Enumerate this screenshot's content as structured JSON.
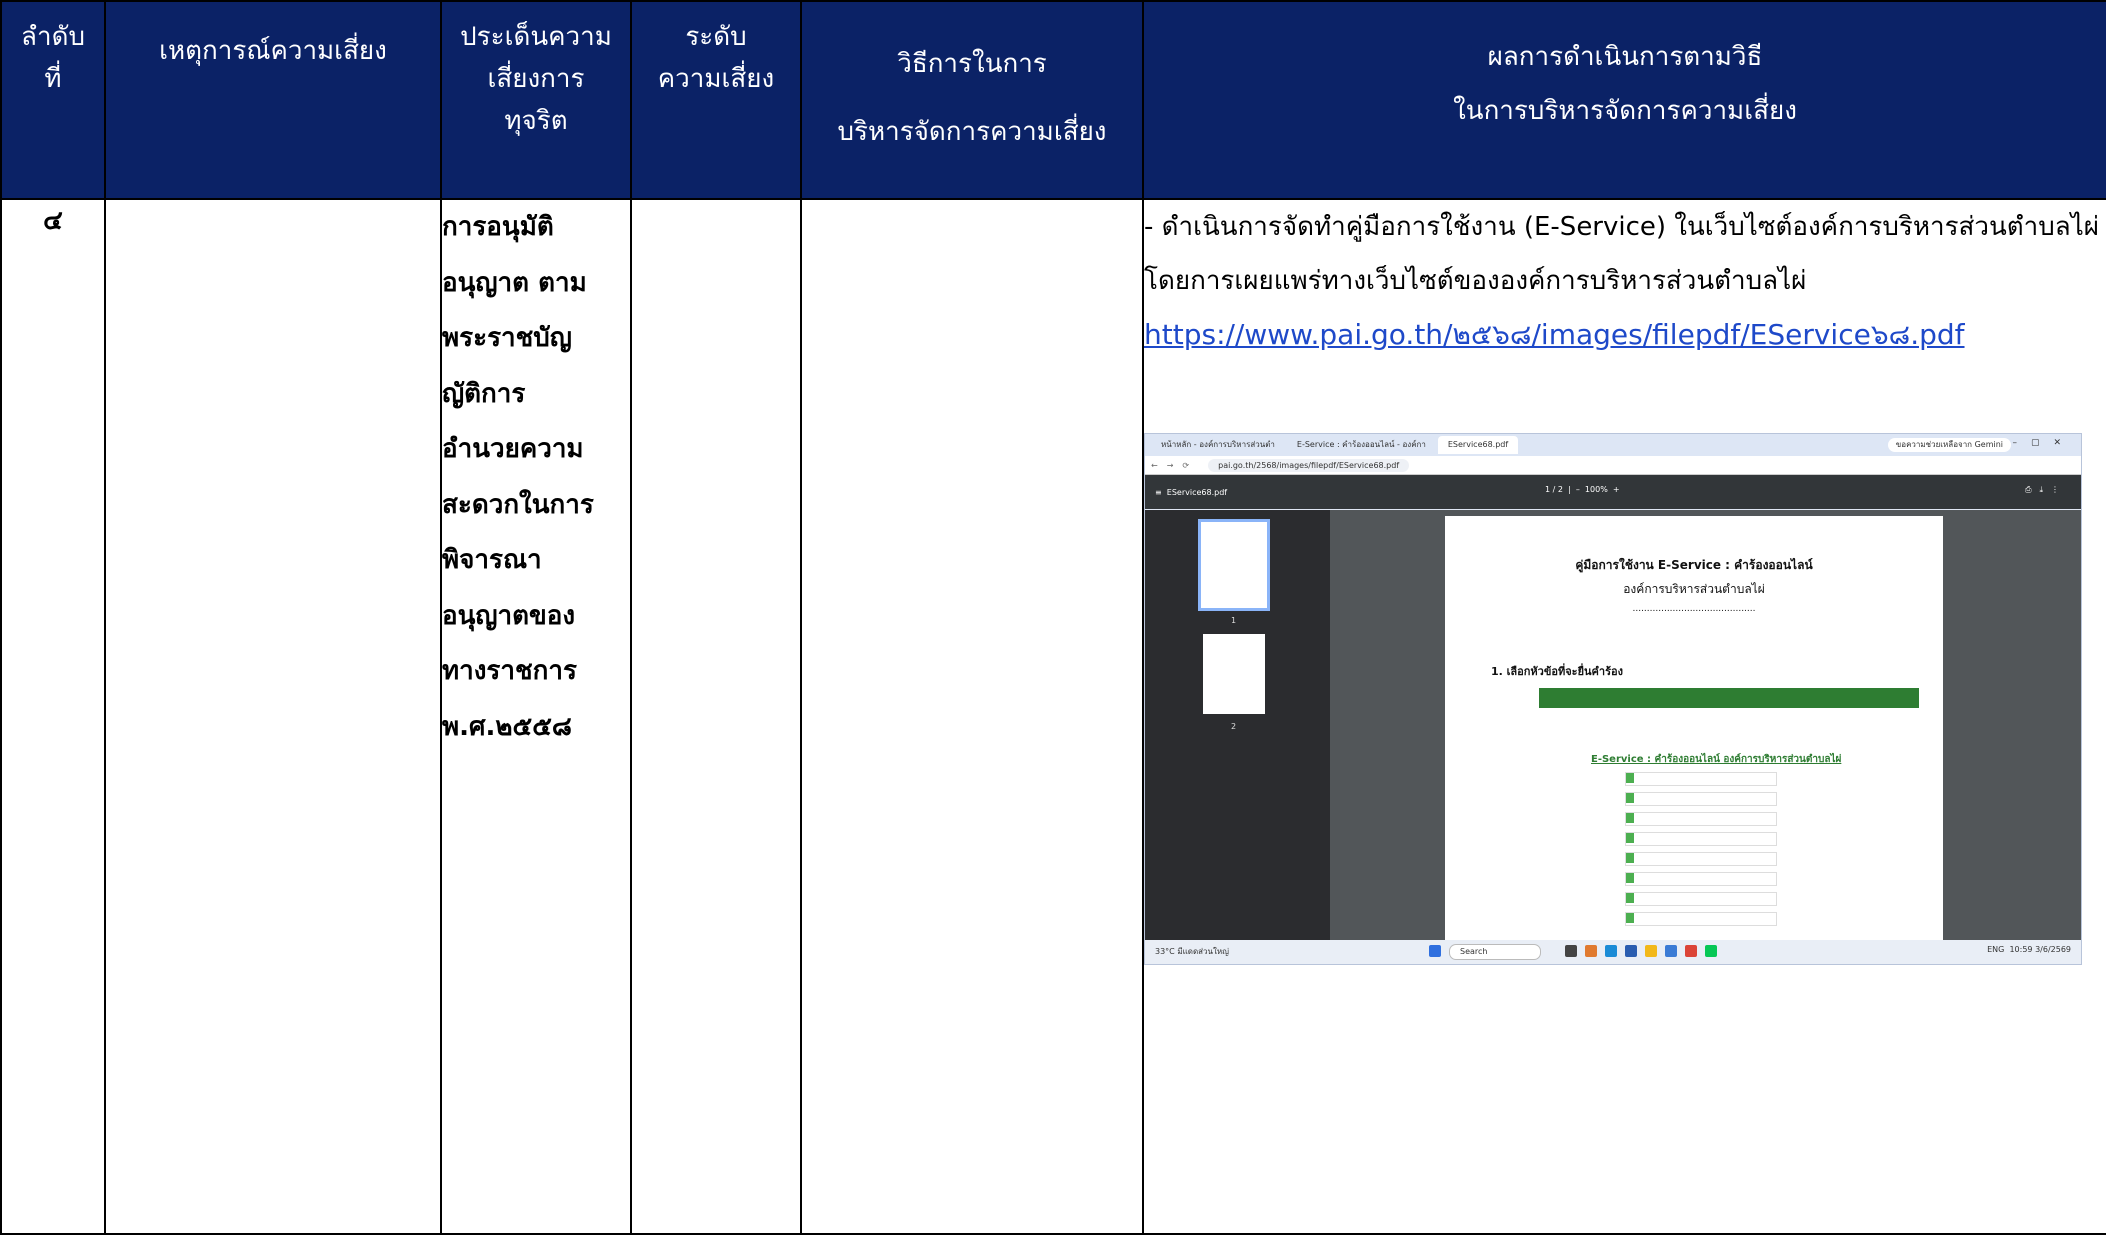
{
  "header": {
    "col1": [
      "ลำดับ",
      "ที่"
    ],
    "col2": [
      "เหตุการณ์ความเสี่ยง"
    ],
    "col3": [
      "ประเด็นความ",
      "เสี่ยงการ",
      "ทุจริต"
    ],
    "col4": [
      "ระดับ",
      "ความเสี่ยง"
    ],
    "col5": [
      "วิธีการในการ",
      "บริหารจัดการความเสี่ยง"
    ],
    "col6": [
      "ผลการดำเนินการตามวิธี",
      "ในการบริหารจัดการความเสี่ยง"
    ]
  },
  "row": {
    "number": "๔",
    "event": "",
    "issue_lines": [
      "การอนุมัติ",
      "อนุญาต ตาม",
      "พระราชบัญ",
      "ญัติการ",
      "อำนวยความ",
      "สะดวกในการ",
      "พิจารณา",
      "อนุญาตของ",
      "ทางราชการ",
      "พ.ศ.๒๕๕๘"
    ],
    "level": "",
    "method": "",
    "result_line1": "- ดำเนินการจัดทำคู่มือการใช้งาน (E-Service) ในเว็บไซต์องค์การบริหารส่วนตำบลไผ่",
    "result_line2": "โดยการเผยแพร่ทางเว็บไซต์ขององค์การบริหารส่วนตำบลไผ่",
    "result_link": "https://www.pai.go.th/๒๕๖๘/images/filepdf/EService๖๘.pdf"
  },
  "screenshot": {
    "tabs": [
      "หน้าหลัก - องค์การบริหารส่วนตำ",
      "E-Service : คำร้องออนไลน์ - องค์กา",
      "EService68.pdf"
    ],
    "gemini": "ขอความช่วยเหลือจาก Gemini",
    "url": "pai.go.th/2568/images/filepdf/EService68.pdf",
    "pdf_name": "EService68.pdf",
    "page_indicator": "1 / 2",
    "zoom": "100%",
    "thumb1": "1",
    "thumb2": "2",
    "doc_title": "คู่มือการใช้งาน E-Service : คำร้องออนไลน์",
    "doc_subtitle": "องค์การบริหารส่วนตำบลไผ่",
    "doc_dots": "...........................................",
    "step1": "1. เลือกหัวข้อที่จะยื่นคำร้อง",
    "eservice_heading": "E-Service : คำร้องออนไลน์ องค์การบริหารส่วนตำบลไผ่",
    "search": "Search",
    "weather": "33°C",
    "weather_sub": "มีแดดส่วนใหญ่",
    "tray": "ENG",
    "clock": "10:59",
    "date": "3/6/2569"
  }
}
